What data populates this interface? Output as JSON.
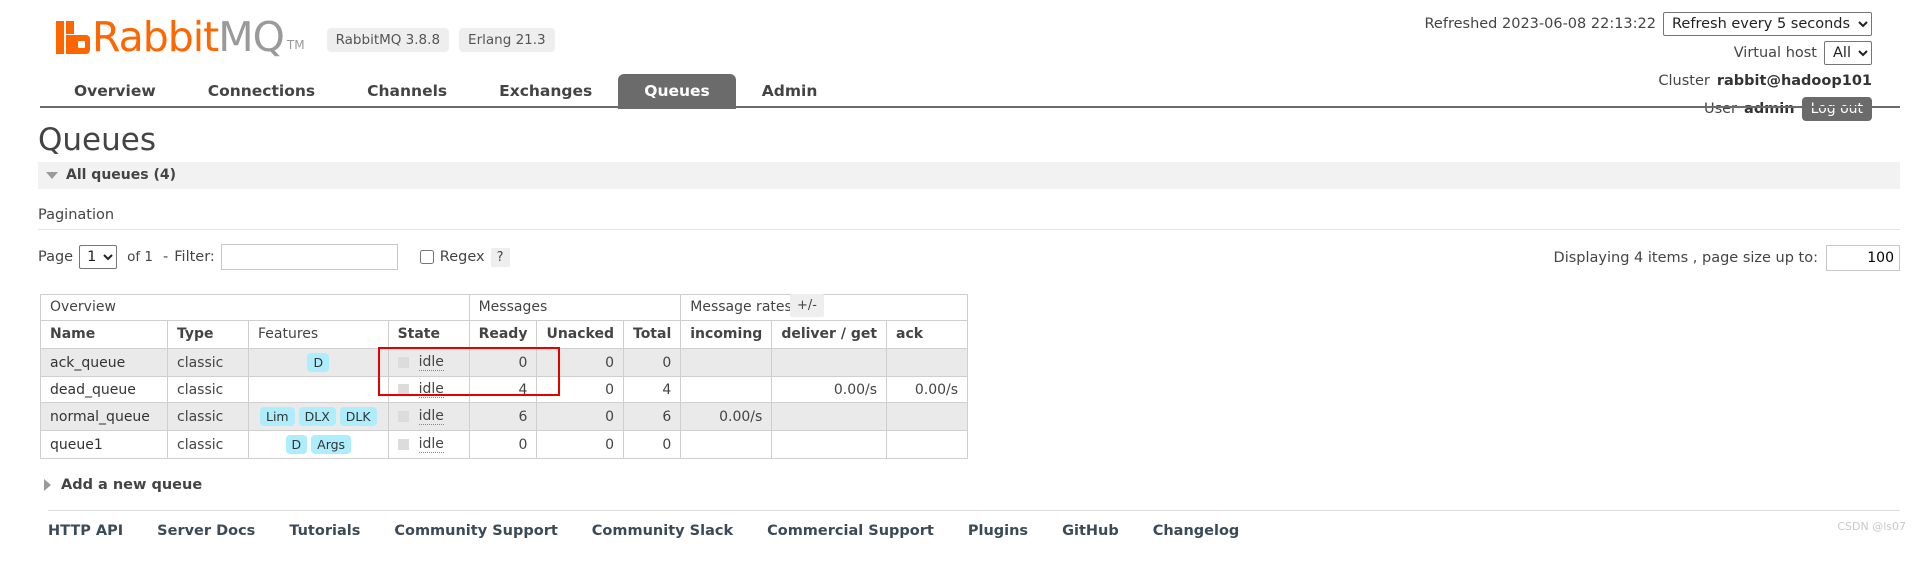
{
  "header": {
    "brand_rabbit": "Rabbit",
    "brand_mq": "MQ",
    "trademark": "TM",
    "versions": [
      "RabbitMQ 3.8.8",
      "Erlang 21.3"
    ],
    "refreshed_label": "Refreshed 2023-06-08 22:13:22",
    "refresh_select_value": "Refresh every 5 seconds",
    "refresh_options": [
      "Refresh every 5 seconds"
    ],
    "vhost_label": "Virtual host",
    "vhost_value": "All",
    "vhost_options": [
      "All"
    ],
    "cluster_label": "Cluster",
    "cluster_name": "rabbit@hadoop101",
    "user_label": "User",
    "user_name": "admin",
    "logout_label": "Log out"
  },
  "nav": {
    "tabs": [
      {
        "label": "Overview",
        "active": false
      },
      {
        "label": "Connections",
        "active": false
      },
      {
        "label": "Channels",
        "active": false
      },
      {
        "label": "Exchanges",
        "active": false
      },
      {
        "label": "Queues",
        "active": true
      },
      {
        "label": "Admin",
        "active": false
      }
    ]
  },
  "main": {
    "page_title": "Queues",
    "all_queues_label": "All queues (4)",
    "pagination_label": "Pagination",
    "page_label": "Page",
    "page_value": "1",
    "page_options": [
      "1"
    ],
    "of_label": "of 1",
    "dash": "-",
    "filter_label": "Filter:",
    "filter_value": "",
    "filter_placeholder": "",
    "regex_label": "Regex",
    "regex_checked": false,
    "help_label": "?",
    "displaying_label": "Displaying 4 items , page size up to:",
    "page_size_value": "100",
    "plusminus_label": "+/-"
  },
  "table": {
    "group_headers": [
      {
        "label": "Overview",
        "span": 4
      },
      {
        "label": "Messages",
        "span": 3
      },
      {
        "label": "Message rates",
        "span": 3
      }
    ],
    "columns": [
      {
        "label": "Name",
        "align": "left",
        "bold": true
      },
      {
        "label": "Type",
        "align": "left",
        "bold": true
      },
      {
        "label": "Features",
        "align": "left",
        "bold": false
      },
      {
        "label": "State",
        "align": "left",
        "bold": true
      },
      {
        "label": "Ready",
        "align": "right",
        "bold": true
      },
      {
        "label": "Unacked",
        "align": "right",
        "bold": true
      },
      {
        "label": "Total",
        "align": "right",
        "bold": true
      },
      {
        "label": "incoming",
        "align": "left",
        "bold": true
      },
      {
        "label": "deliver / get",
        "align": "left",
        "bold": true
      },
      {
        "label": "ack",
        "align": "left",
        "bold": true
      }
    ],
    "rows": [
      {
        "name": "ack_queue",
        "type": "classic",
        "features": [
          "D"
        ],
        "state": "idle",
        "ready": "0",
        "unacked": "0",
        "total": "0",
        "incoming": "",
        "deliver_get": "",
        "ack": ""
      },
      {
        "name": "dead_queue",
        "type": "classic",
        "features": [],
        "state": "idle",
        "ready": "4",
        "unacked": "0",
        "total": "4",
        "incoming": "",
        "deliver_get": "0.00/s",
        "ack": "0.00/s"
      },
      {
        "name": "normal_queue",
        "type": "classic",
        "features": [
          "Lim",
          "DLX",
          "DLK"
        ],
        "state": "idle",
        "ready": "6",
        "unacked": "0",
        "total": "6",
        "incoming": "0.00/s",
        "deliver_get": "",
        "ack": ""
      },
      {
        "name": "queue1",
        "type": "classic",
        "features": [
          "D",
          "Args"
        ],
        "state": "idle",
        "ready": "0",
        "unacked": "0",
        "total": "0",
        "incoming": "",
        "deliver_get": "",
        "ack": ""
      }
    ]
  },
  "add_queue": {
    "label": "Add a new queue"
  },
  "footer": {
    "links": [
      "HTTP API",
      "Server Docs",
      "Tutorials",
      "Community Support",
      "Community Slack",
      "Commercial Support",
      "Plugins",
      "GitHub",
      "Changelog"
    ],
    "watermark": "CSDN @ls07"
  },
  "colors": {
    "brand_orange": "#ff6600",
    "tab_active_bg": "#6b6b6b",
    "feature_tag_bg": "#aeeefc",
    "annotation_red": "#e60000"
  }
}
